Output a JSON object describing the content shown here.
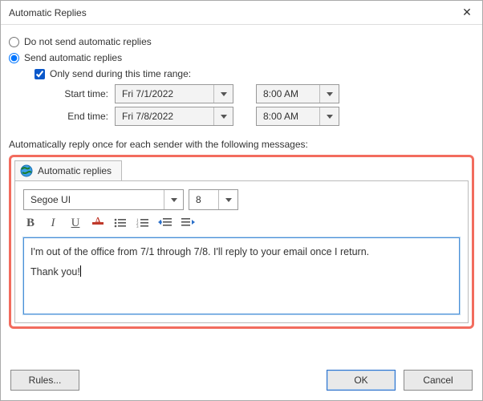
{
  "window": {
    "title": "Automatic Replies"
  },
  "options": {
    "do_not_send_label": "Do not send automatic replies",
    "send_label": "Send automatic replies",
    "only_during_range_label": "Only send during this time range:",
    "start_label": "Start time:",
    "end_label": "End time:",
    "start_date": "Fri 7/1/2022",
    "start_time": "8:00 AM",
    "end_date": "Fri 7/8/2022",
    "end_time": "8:00 AM"
  },
  "reply_note": "Automatically reply once for each sender with the following messages:",
  "tab": {
    "label": "Automatic replies"
  },
  "editor": {
    "font_family": "Segoe UI",
    "font_size": "8",
    "message_line1": "I'm out of the office from 7/1 through 7/8. I'll reply to your email once I return.",
    "message_line2": "Thank you!"
  },
  "footer": {
    "rules_label": "Rules...",
    "ok_label": "OK",
    "cancel_label": "Cancel"
  }
}
